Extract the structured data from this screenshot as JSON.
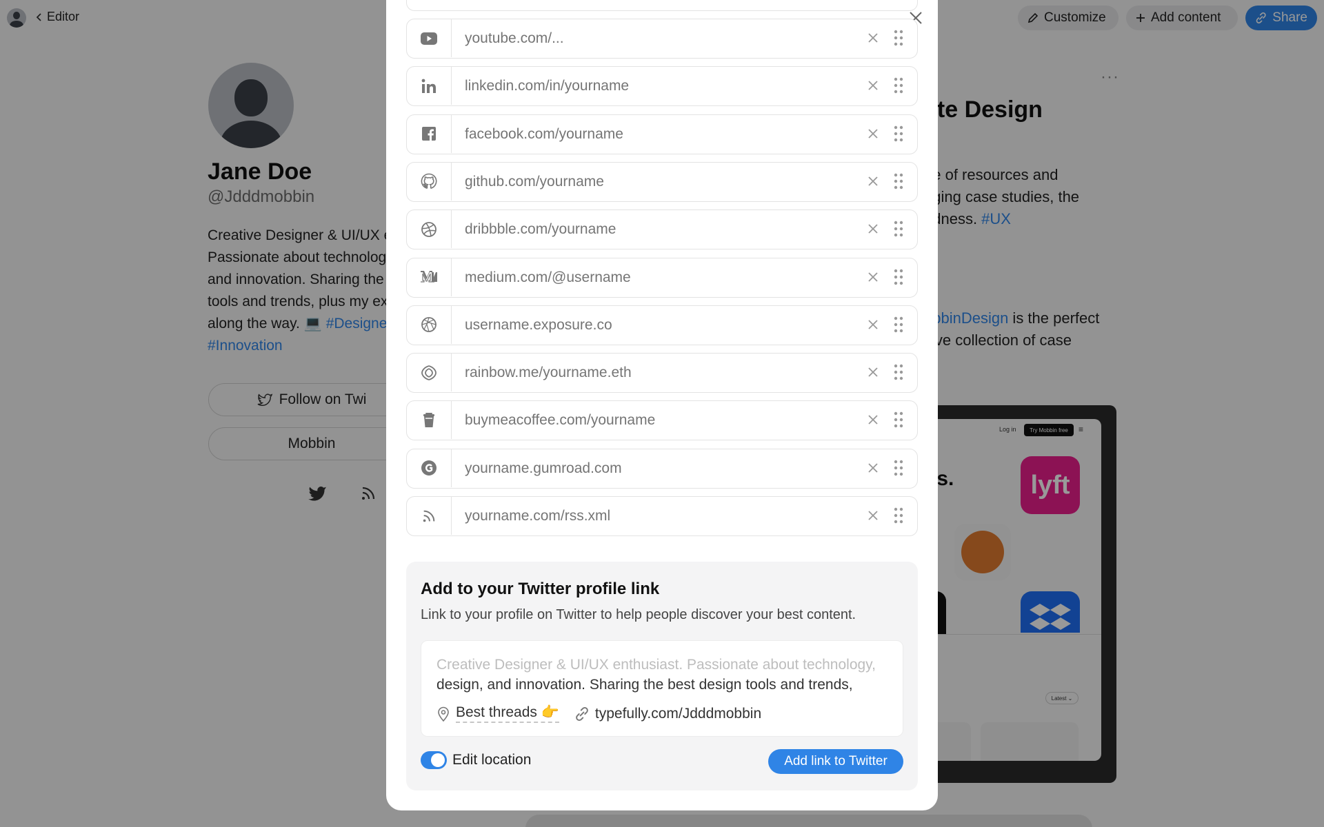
{
  "topbar": {
    "editor_label": "Editor",
    "customize_label": "Customize",
    "add_content_label": "Add content",
    "share_label": "Share"
  },
  "profile": {
    "name": "Jane Doe",
    "handle": "@Jdddmobbin",
    "bio_lines": [
      "Creative Designer & UI/UX e",
      "Passionate about technolog",
      "and innovation. Sharing the",
      "tools and trends, plus my ex",
      "along the way. 💻 "
    ],
    "bio_tag_1": "#Designe",
    "bio_tag_2": "#Innovation",
    "follow_label": "Follow on Twi",
    "mobbin_label": "Mobbin"
  },
  "content_card": {
    "menu": "···",
    "title": "ate Design",
    "lines": [
      "ne of resources and",
      "nging case studies, the",
      "odness. "
    ],
    "tag_ux": "#UX",
    "line4_tag": "obbinDesign",
    "line4_rest": " is the perfect",
    "line5": "sive collection of case",
    "preview": {
      "login": "Log in",
      "try": "Try Mobbin free",
      "heading": "ps.",
      "sort": "Latest"
    }
  },
  "modal": {
    "links": [
      {
        "icon": "youtube-icon",
        "placeholder": "youtube.com/..."
      },
      {
        "icon": "linkedin-icon",
        "placeholder": "linkedin.com/in/yourname"
      },
      {
        "icon": "facebook-icon",
        "placeholder": "facebook.com/yourname"
      },
      {
        "icon": "github-icon",
        "placeholder": "github.com/yourname"
      },
      {
        "icon": "dribbble-icon",
        "placeholder": "dribbble.com/yourname"
      },
      {
        "icon": "medium-icon",
        "placeholder": "medium.com/@username"
      },
      {
        "icon": "exposure-icon",
        "placeholder": "username.exposure.co"
      },
      {
        "icon": "rainbow-icon",
        "placeholder": "rainbow.me/yourname.eth"
      },
      {
        "icon": "buymeacoffee-icon",
        "placeholder": "buymeacoffee.com/yourname"
      },
      {
        "icon": "gumroad-icon",
        "placeholder": "yourname.gumroad.com"
      },
      {
        "icon": "rss-icon",
        "placeholder": "yourname.com/rss.xml"
      }
    ],
    "twitter": {
      "title": "Add to your Twitter profile link",
      "subtitle": "Link to your profile on Twitter to help people discover your best content.",
      "bio_line1": "Creative Designer & UI/UX enthusiast. Passionate about technology,",
      "bio_line2": "design, and innovation. Sharing the best design tools and trends,",
      "location": "Best threads 👉",
      "url": "typefully.com/Jdddmobbin",
      "toggle_label": "Edit location",
      "toggle_on": true,
      "button_label": "Add link to Twitter"
    }
  },
  "colors": {
    "accent": "#2f84e6",
    "overlay": "rgba(0,0,0,0.40)",
    "lyft": "#e91e8c",
    "dropbox": "#1e6ff5",
    "orange": "#e07a2f"
  }
}
